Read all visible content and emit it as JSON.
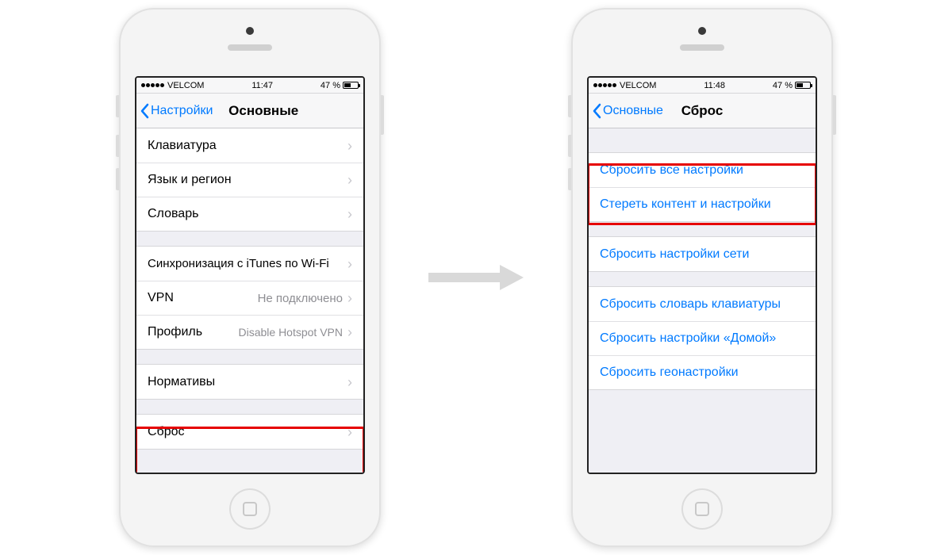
{
  "carrier": "VELCOM",
  "battery": "47 %",
  "left": {
    "time": "11:47",
    "back": "Настройки",
    "title": "Основные",
    "group1": [
      {
        "label": "Клавиатура"
      },
      {
        "label": "Язык и регион"
      },
      {
        "label": "Словарь"
      }
    ],
    "group2": [
      {
        "label": "Синхронизация с iTunes по Wi-Fi"
      },
      {
        "label": "VPN",
        "detail": "Не подключено"
      },
      {
        "label": "Профиль",
        "detail": "Disable Hotspot VPN"
      }
    ],
    "group3": [
      {
        "label": "Нормативы"
      }
    ],
    "group4": [
      {
        "label": "Сброс"
      }
    ]
  },
  "right": {
    "time": "11:48",
    "back": "Основные",
    "title": "Сброс",
    "group1": [
      {
        "label": "Сбросить все настройки"
      },
      {
        "label": "Стереть контент и настройки"
      }
    ],
    "group2": [
      {
        "label": "Сбросить настройки сети"
      }
    ],
    "group3": [
      {
        "label": "Сбросить словарь клавиатуры"
      },
      {
        "label": "Сбросить настройки «Домой»"
      },
      {
        "label": "Сбросить геонастройки"
      }
    ]
  }
}
